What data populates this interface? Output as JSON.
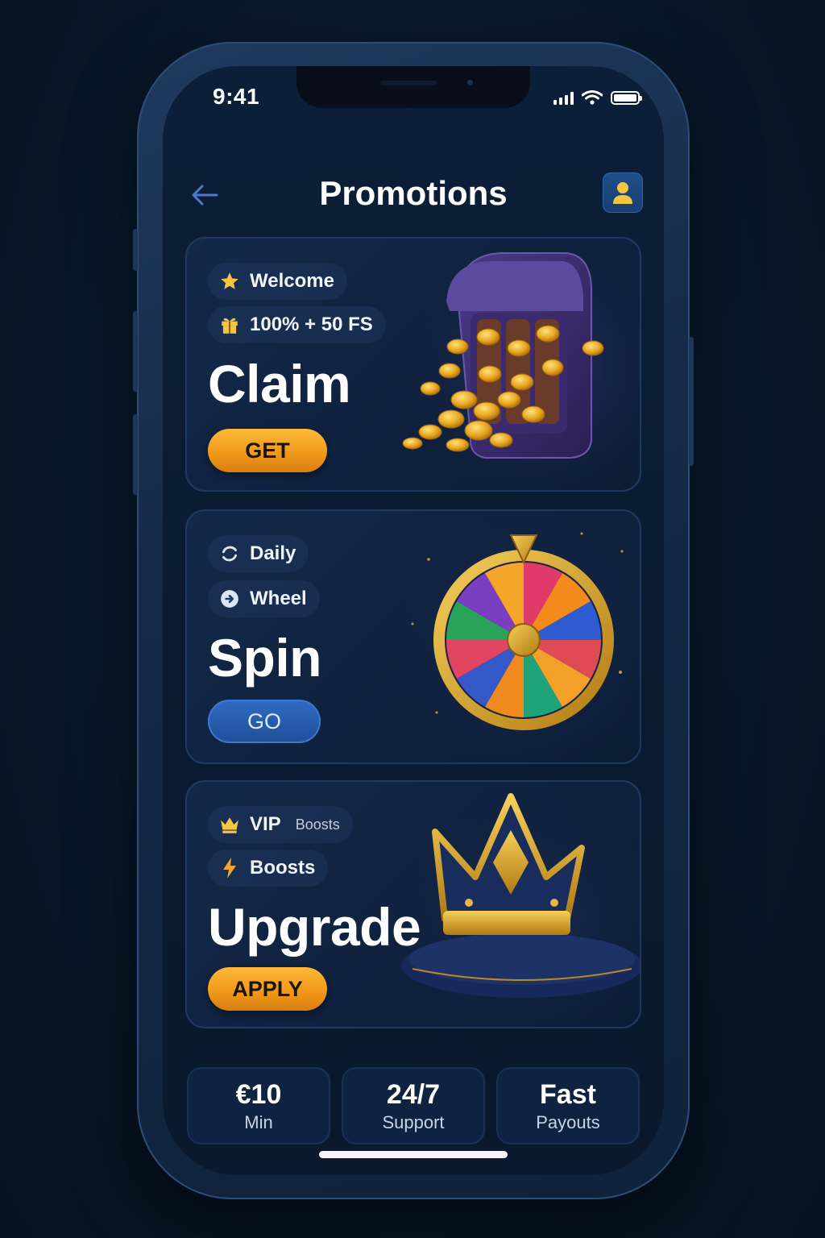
{
  "status_bar": {
    "time": "9:41"
  },
  "header": {
    "title": "Promotions"
  },
  "cards": [
    {
      "chips": [
        {
          "icon": "star-icon",
          "label": "Welcome"
        },
        {
          "icon": "gift-icon",
          "label": "100% + 50 FS"
        }
      ],
      "title": "Claim",
      "button": "GET",
      "art": "slot-machine-coins-illustration"
    },
    {
      "chips": [
        {
          "icon": "refresh-icon",
          "label": "Daily"
        },
        {
          "icon": "arrow-right-circle-icon",
          "label": "Wheel"
        }
      ],
      "title": "Spin",
      "button": "GO",
      "art": "prize-wheel-illustration"
    },
    {
      "chips": [
        {
          "icon": "crown-icon",
          "label": "VIP",
          "sub": "Boosts"
        },
        {
          "icon": "lightning-icon",
          "label": "Boosts"
        }
      ],
      "title": "Upgrade",
      "button": "APPLY",
      "art": "crown-on-pillow-illustration"
    }
  ],
  "stats": [
    {
      "value": "€10",
      "label": "Min"
    },
    {
      "value": "24/7",
      "label": "Support"
    },
    {
      "value": "Fast",
      "label": "Payouts"
    }
  ],
  "colors": {
    "accent_orange": "#f19a1a",
    "accent_blue": "#1f4f98",
    "gold": "#f3c23a"
  }
}
